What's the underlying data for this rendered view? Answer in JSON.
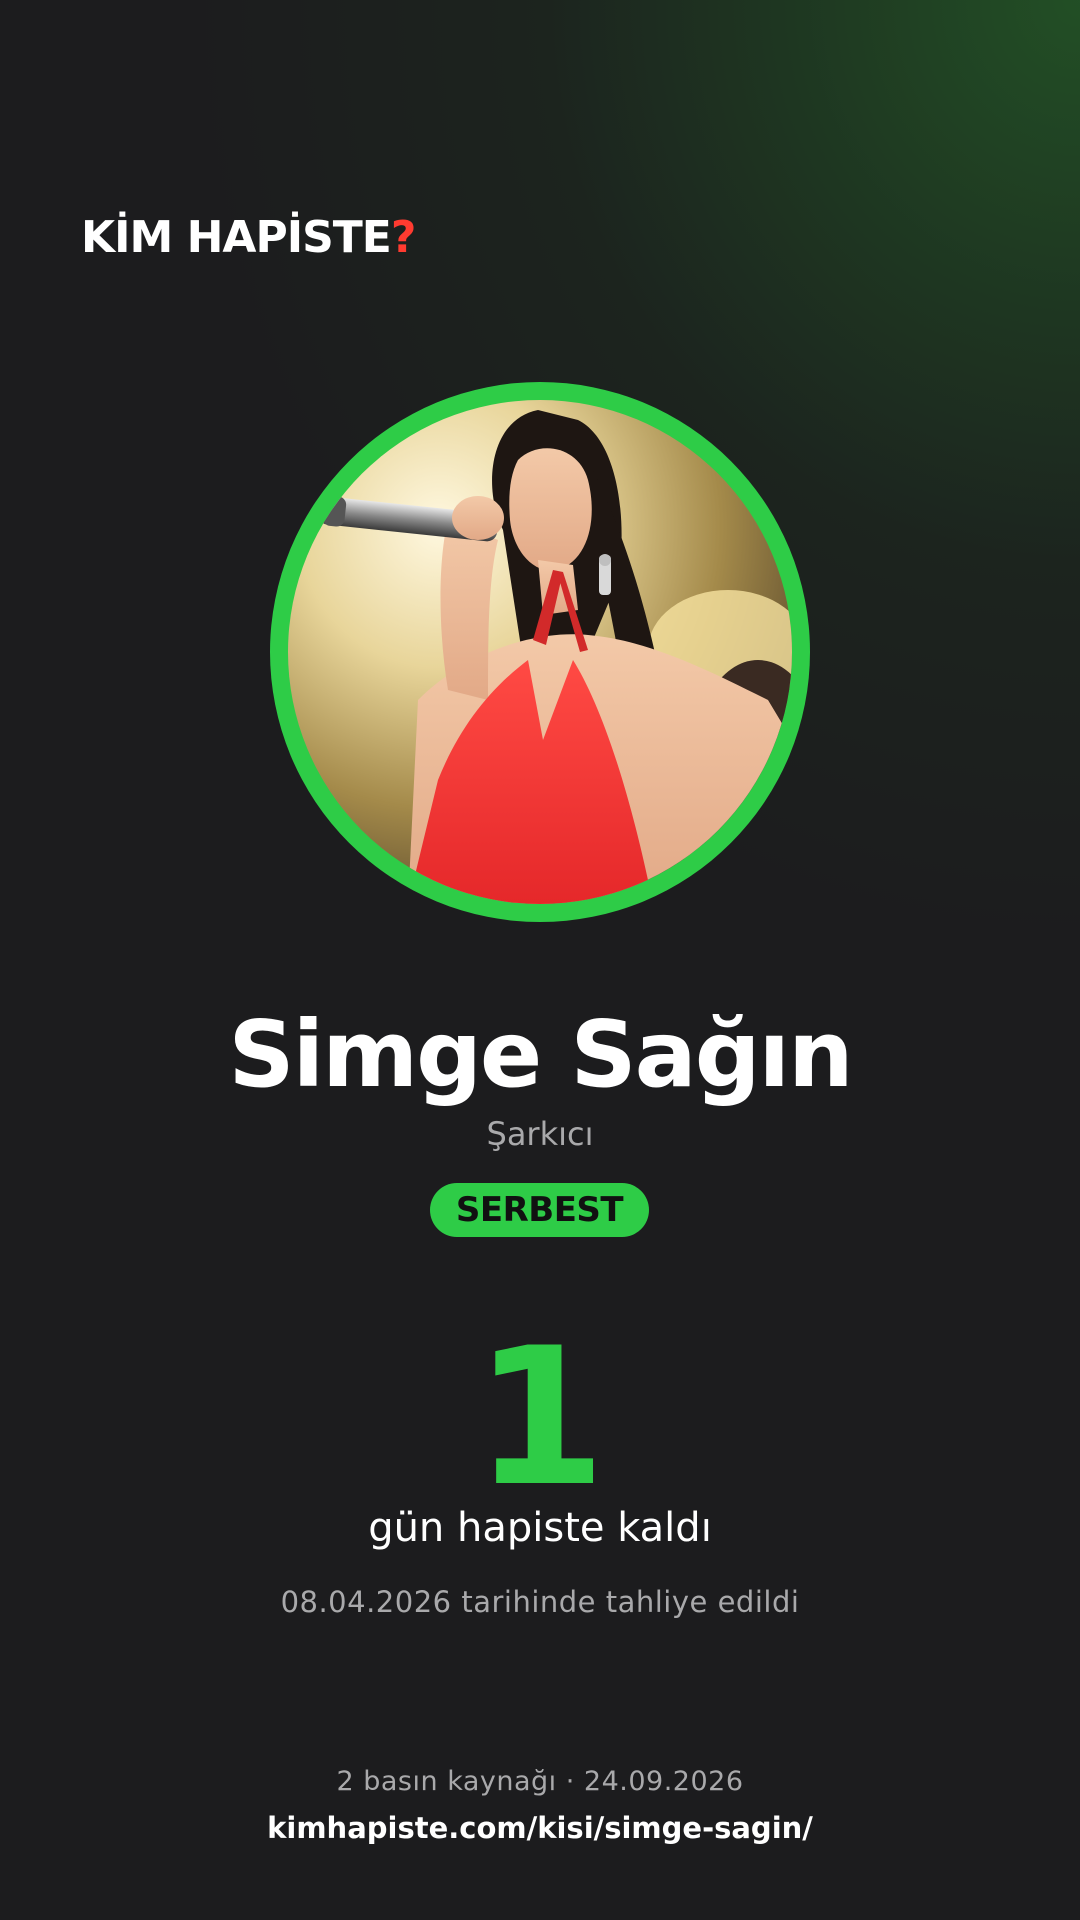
{
  "brand": {
    "name": "KİM HAPİSTE",
    "mark": "?"
  },
  "profile": {
    "photo_subject": "woman singing into microphone in red dress",
    "name": "Simge Sağın",
    "role": "Şarkıcı",
    "status": "SERBEST"
  },
  "stats": {
    "days": "1",
    "days_label": "gün hapiste kaldı",
    "release_note": "08.04.2026 tarihinde tahliye edildi"
  },
  "footer": {
    "sources": "2 basın kaynağı · 24.09.2026",
    "url": "kimhapiste.com/kisi/simge-sagin/"
  },
  "colors": {
    "background": "#1c1c1e",
    "accent_green": "#2ecc47",
    "question_mark": "#ff3b30",
    "muted_text": "#a9a9ab"
  }
}
